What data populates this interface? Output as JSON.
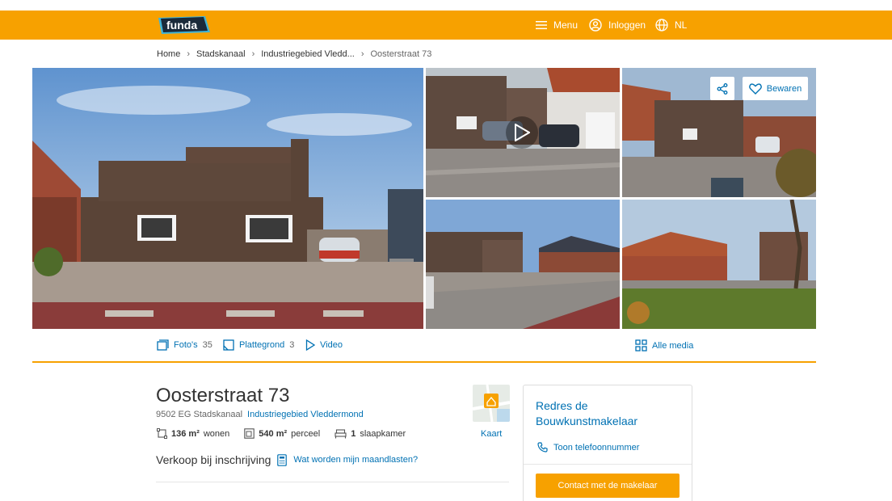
{
  "header": {
    "logo_text": "funda",
    "menu_label": "Menu",
    "login_label": "Inloggen",
    "lang_label": "NL"
  },
  "breadcrumb": {
    "items": [
      "Home",
      "Stadskanaal",
      "Industriegebied Vledd...",
      "Oosterstraat 73"
    ]
  },
  "photo_actions": {
    "save_label": "Bewaren"
  },
  "media_bar": {
    "photos_label": "Foto's",
    "photos_count": "35",
    "floorplan_label": "Plattegrond",
    "floorplan_count": "3",
    "video_label": "Video",
    "all_media_label": "Alle media"
  },
  "listing": {
    "title": "Oosterstraat 73",
    "postcode_city": "9502 EG Stadskanaal",
    "neighborhood": "Industriegebied Vleddermond",
    "living_area_value": "136 m²",
    "living_area_label": "wonen",
    "plot_area_value": "540 m²",
    "plot_area_label": "perceel",
    "bedrooms_value": "1",
    "bedrooms_label": "slaapkamer",
    "sale_type": "Verkoop bij inschrijving",
    "costs_link": "Wat worden mijn maandlasten?",
    "map_label": "Kaart"
  },
  "agent": {
    "name": "Redres de Bouwkunstmakelaar",
    "phone_label": "Toon telefoonnummer",
    "contact_button": "Contact met de makelaar"
  },
  "colors": {
    "brand_orange": "#f7a100",
    "link_blue": "#0071b3"
  }
}
